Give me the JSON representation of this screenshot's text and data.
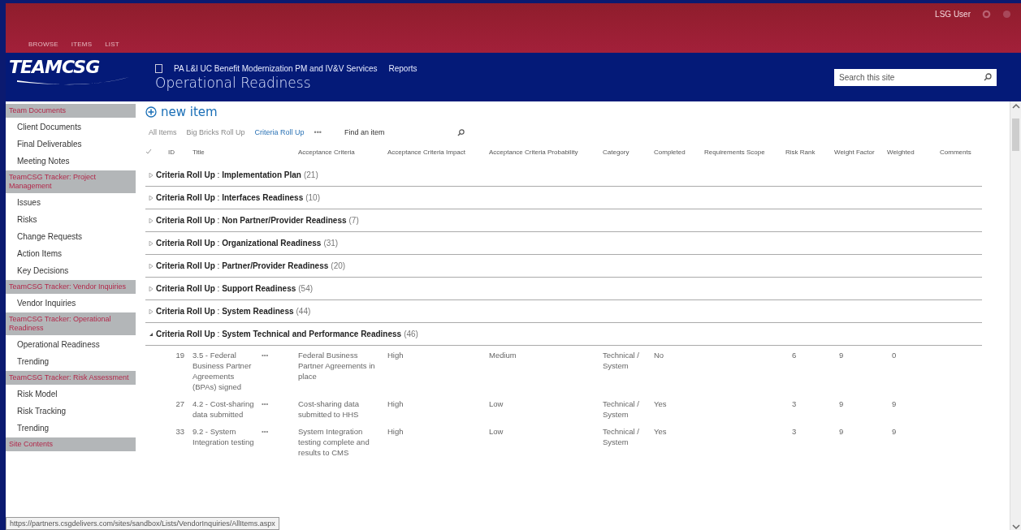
{
  "top_bar": {
    "user": "LSG User",
    "nav": [
      {
        "label": "BROWSE",
        "selected": false
      },
      {
        "label": "ITEMS",
        "selected": false
      },
      {
        "label": "LIST",
        "selected": false
      }
    ]
  },
  "header": {
    "logo": "TEAMCSG",
    "breadcrumb": [
      "PA L&I UC Benefit Modernization PM and IV&V Services",
      "Reports"
    ],
    "title": "Operational Readiness",
    "search": {
      "placeholder": "Search this site"
    }
  },
  "sidebar": {
    "sections": [
      {
        "heading": "Team Documents",
        "items": [
          "Client Documents",
          "Final Deliverables",
          "Meeting Notes"
        ]
      },
      {
        "heading": "TeamCSG Tracker: Project Management",
        "items": [
          "Issues",
          "Risks",
          "Change Requests",
          "Action Items",
          "Key Decisions"
        ]
      },
      {
        "heading": "TeamCSG Tracker: Vendor Inquiries",
        "items": [
          "Vendor Inquiries"
        ]
      },
      {
        "heading": "TeamCSG Tracker: Operational Readiness",
        "items": [
          "Operational Readiness",
          "Trending"
        ]
      },
      {
        "heading": "TeamCSG Tracker: Risk Assessment",
        "items": [
          "Risk Model",
          "Risk Tracking",
          "Trending"
        ]
      },
      {
        "heading": "Site Contents"
      }
    ]
  },
  "new_item": "new item",
  "views": [
    {
      "label": "All Items",
      "selected": false
    },
    {
      "label": "Big Bricks Roll Up",
      "selected": false
    },
    {
      "label": "Criteria Roll Up",
      "selected": true
    }
  ],
  "more_views": "•••",
  "find": {
    "placeholder": "Find an item"
  },
  "table": {
    "columns": [
      "ID",
      "Title",
      "",
      "Acceptance Criteria",
      "Acceptance Criteria Impact",
      "Acceptance Criteria Probability",
      "Category",
      "Completed",
      "Requirements Scope",
      "Risk Rank",
      "Weight Factor",
      "Weighted",
      "Comments"
    ],
    "groups": [
      {
        "label": "**Criteria Roll Up** : **Implementation Plan**",
        "count": "(21)",
        "expanded": false
      },
      {
        "label": "**Criteria Roll Up** : **Interfaces Readiness**",
        "count": "(10)",
        "expanded": false
      },
      {
        "label": "**Criteria Roll Up** : **Non Partner/Provider Readiness**",
        "count": "(7)",
        "expanded": false
      },
      {
        "label": "**Criteria Roll Up** : **Organizational Readiness**",
        "count": "(31)",
        "expanded": false
      },
      {
        "label": "**Criteria Roll Up** : **Partner/Provider Readiness**",
        "count": "(20)",
        "expanded": false
      },
      {
        "label": "**Criteria Roll Up** : **Support Readiness**",
        "count": "(54)",
        "expanded": false
      },
      {
        "label": "**Criteria Roll Up** : **System Readiness**",
        "count": "(44)",
        "expanded": false
      },
      {
        "label": "**Criteria Roll Up** : **System Technical and Performance Readiness**",
        "count": "(46)",
        "expanded": true,
        "rows": [
          {
            "id": "19",
            "title": "3.5 - Federal Business Partner Agreements (BPAs) signed",
            "menu": "•••",
            "criteria": "Federal Business Partner Agreements in place",
            "impact": "High",
            "probability": "Medium",
            "category": "Technical / System",
            "completed": "No",
            "risk_rank": "6",
            "weight_factor": "9",
            "weighted": "0"
          },
          {
            "id": "27",
            "title": "4.2 - Cost-sharing data submitted",
            "menu": "•••",
            "criteria": "Cost-sharing data submitted to HHS",
            "impact": "High",
            "probability": "Low",
            "category": "Technical / System",
            "completed": "Yes",
            "risk_rank": "3",
            "weight_factor": "9",
            "weighted": "9"
          },
          {
            "id": "33",
            "title": "9.2 - System Integration testing",
            "menu": "•••",
            "criteria": "System Integration testing complete and results to CMS",
            "impact": "High",
            "probability": "Low",
            "category": "Technical / System",
            "completed": "Yes",
            "risk_rank": "3",
            "weight_factor": "9",
            "weighted": "9"
          }
        ]
      }
    ]
  },
  "status_url": "https://partners.csgdelivers.com/sites/sandbox/Lists/VendorInquiries/AllItems.aspx"
}
